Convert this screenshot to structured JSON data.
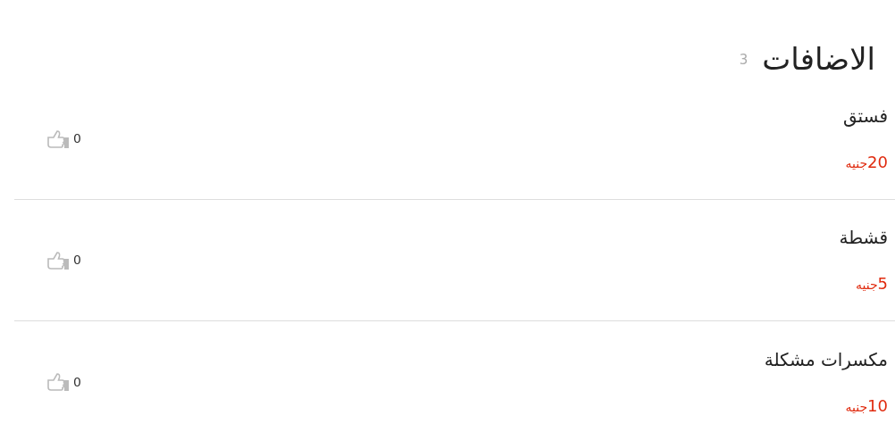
{
  "section": {
    "title": "الاضافات",
    "count": "3"
  },
  "items": [
    {
      "name": "فستق",
      "amount": "20",
      "currency": "جنيه",
      "likes": "0"
    },
    {
      "name": "قشطة",
      "amount": "5",
      "currency": "جنيه",
      "likes": "0"
    },
    {
      "name": "مكسرات مشكلة",
      "amount": "10",
      "currency": "جنيه",
      "likes": "0"
    }
  ]
}
